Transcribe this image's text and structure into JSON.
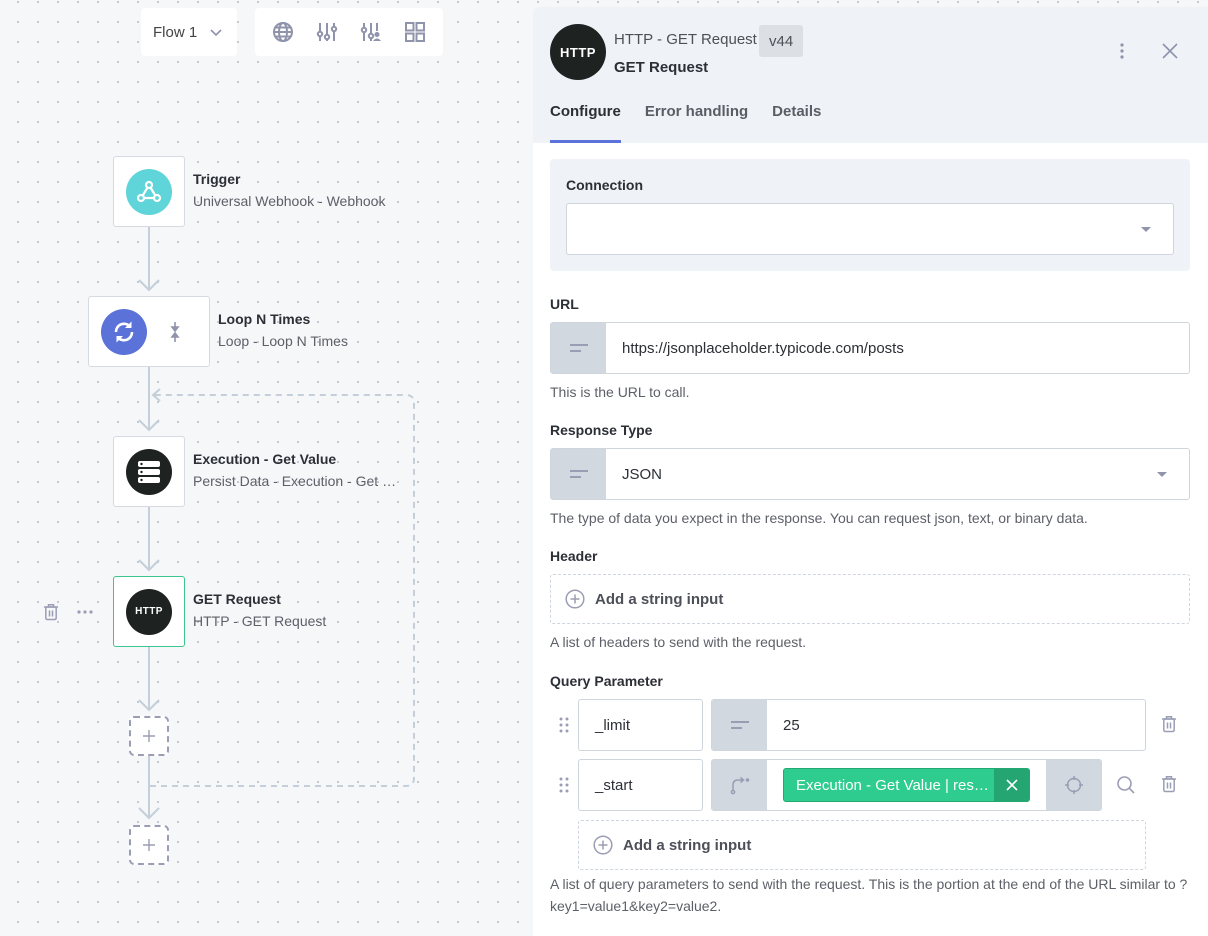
{
  "toolbar": {
    "flow_select": "Flow 1",
    "icons": [
      "globe-icon",
      "sliders-icon",
      "sliders-user-icon",
      "grid-icon"
    ]
  },
  "canvas": {
    "nodes": [
      {
        "title": "Trigger",
        "subtitle": "Universal Webhook - Webhook",
        "icon": "webhook-icon",
        "color": "#5fd5d9"
      },
      {
        "title": "Loop N Times",
        "subtitle": "Loop - Loop N Times",
        "icon": "loop-icon",
        "color": "#5b72d8"
      },
      {
        "title": "Execution - Get Value",
        "subtitle": "Persist Data - Execution - Get …",
        "icon": "database-icon",
        "color": "#1e2221"
      },
      {
        "title": "GET Request",
        "subtitle": "HTTP - GET Request",
        "icon": "http-icon",
        "icon_text": "HTTP",
        "color": "#1e2221",
        "selected": true
      }
    ],
    "add_step_label": "+"
  },
  "panel": {
    "logo_text": "HTTP",
    "type": "HTTP - GET Request",
    "version": "v44",
    "name": "GET Request",
    "tabs": [
      {
        "label": "Configure",
        "active": true
      },
      {
        "label": "Error handling",
        "active": false
      },
      {
        "label": "Details",
        "active": false
      }
    ],
    "connection": {
      "label": "Connection",
      "value": ""
    },
    "url": {
      "label": "URL",
      "value": "https://jsonplaceholder.typicode.com/posts",
      "help": "This is the URL to call."
    },
    "response_type": {
      "label": "Response Type",
      "value": "JSON",
      "help": "The type of data you expect in the response. You can request json, text, or binary data."
    },
    "header": {
      "label": "Header",
      "add_label": "Add a string input",
      "help": "A list of headers to send with the request."
    },
    "query": {
      "label": "Query Parameter",
      "rows": [
        {
          "key": "_limit",
          "value": "25"
        },
        {
          "key": "_start",
          "chip": "Execution - Get Value | res…"
        }
      ],
      "add_label": "Add a string input",
      "help": "A list of query parameters to send with the request. This is the portion at the end of the URL similar to ?key1=value1&key2=value2."
    }
  },
  "colors": {
    "accent": "#5b72d8",
    "selected_border": "#3cc58f",
    "chip_green": "#2ecc8f"
  }
}
